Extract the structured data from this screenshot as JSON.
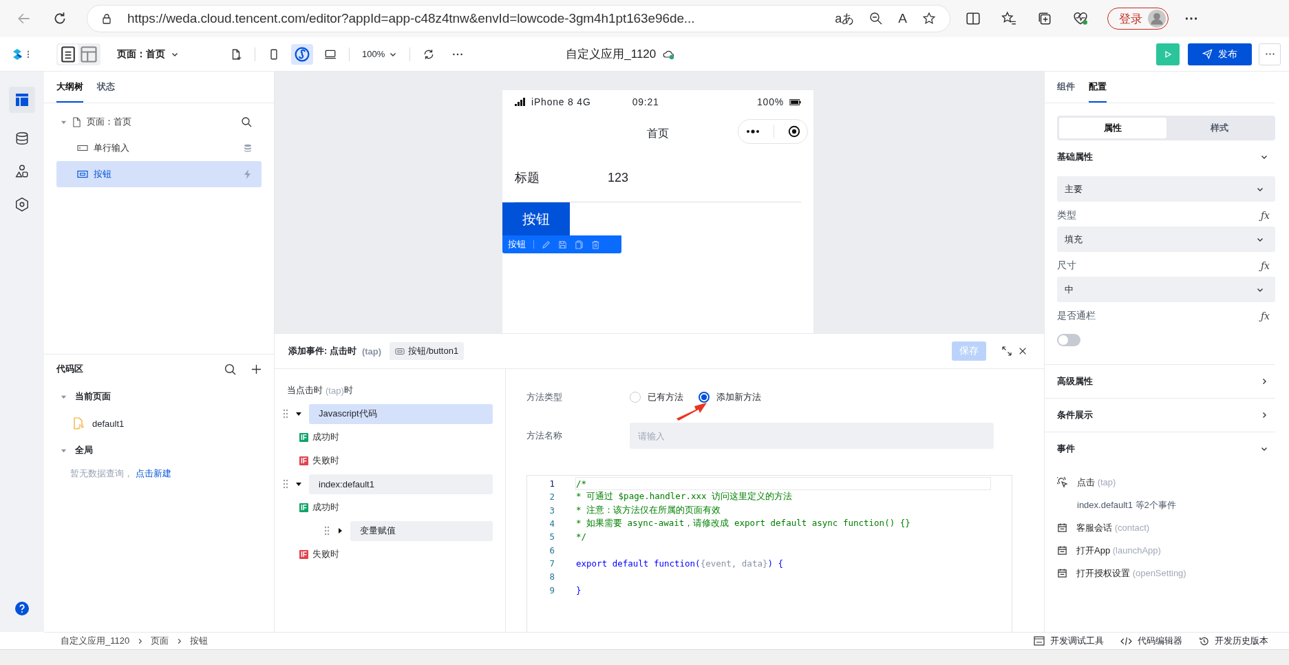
{
  "browser": {
    "url": "https://weda.cloud.tencent.com/editor?appId=app-c48z4tnw&envId=lowcode-3gm4h1pt163e96de...",
    "translate_glyph": "aあ",
    "read_aloud_glyph": "A",
    "login_label": "登录"
  },
  "header": {
    "page_selector": "页面：首页",
    "zoom": "100%",
    "app_title": "自定义应用_1120",
    "publish_label": "发布"
  },
  "left_tabs": [
    {
      "label": "大纲树",
      "selected": true
    },
    {
      "label": "状态",
      "selected": false
    }
  ],
  "outline": [
    {
      "kind": "page",
      "label": "页面：首页",
      "expanded": true,
      "selected": false,
      "children": [
        {
          "kind": "input",
          "label": "单行输入",
          "selected": false
        },
        {
          "kind": "button",
          "label": "按钮",
          "selected": true
        }
      ]
    }
  ],
  "code_area": {
    "title": "代码区",
    "groups": [
      {
        "label": "当前页面",
        "expanded": true,
        "files": [
          "default1"
        ]
      },
      {
        "label": "全局",
        "expanded": true,
        "empty_text": "暂无数据查询，",
        "empty_link": "点击新建"
      }
    ]
  },
  "phone": {
    "carrier": "iPhone 8  4G",
    "time": "09:21",
    "battery": "100%",
    "nav_title": "首页",
    "field_label": "标题",
    "field_value": "123",
    "button_label": "按钮",
    "toolbar_label": "按钮"
  },
  "dialog": {
    "title": "添加事件: 点击时",
    "title_code": "(tap)",
    "component_chip": "按钮/button1",
    "save_label": "保存",
    "save_disabled": true,
    "flow_header": {
      "prefix": "当点击时",
      "code": "(tap)",
      "suffix": "时"
    },
    "flow": [
      {
        "kind": "action",
        "label": "Javascript代码",
        "expanded": true,
        "selected": true,
        "children": [
          {
            "kind": "branch",
            "failure": false,
            "badge": "IF",
            "label": "成功时"
          },
          {
            "kind": "branch",
            "failure": true,
            "badge": "IF",
            "label": "失败时"
          }
        ]
      },
      {
        "kind": "action",
        "label": "index:default1",
        "expanded": true,
        "selected": false,
        "children": [
          {
            "kind": "branch",
            "failure": false,
            "badge": "IF",
            "label": "成功时",
            "children": [
              {
                "kind": "action",
                "label": "变量赋值",
                "expanded": false,
                "selected": false
              }
            ]
          },
          {
            "kind": "branch",
            "failure": true,
            "badge": "IF",
            "label": "失败时"
          }
        ]
      }
    ],
    "method_type_label": "方法类型",
    "method_options": [
      {
        "label": "已有方法",
        "selected": false
      },
      {
        "label": "添加新方法",
        "selected": true
      }
    ],
    "method_name_label": "方法名称",
    "method_name_placeholder": "请输入",
    "code_lines": [
      {
        "number": "1",
        "current": true,
        "tokens": [
          {
            "kind": "comment",
            "text": "/*"
          }
        ]
      },
      {
        "number": "2",
        "current": false,
        "tokens": [
          {
            "kind": "comment",
            "text": "* 可通过 $page.handler.xxx 访问这里定义的方法"
          }
        ]
      },
      {
        "number": "3",
        "current": false,
        "tokens": [
          {
            "kind": "comment",
            "text": "* 注意：该方法仅在所属的页面有效"
          }
        ]
      },
      {
        "number": "4",
        "current": false,
        "tokens": [
          {
            "kind": "comment",
            "text": "* 如果需要 async-await，请修改成 export default async function() {}"
          }
        ]
      },
      {
        "number": "5",
        "current": false,
        "tokens": [
          {
            "kind": "comment",
            "text": "*/"
          }
        ]
      },
      {
        "number": "6",
        "current": false
      },
      {
        "number": "7",
        "current": false,
        "tokens": [
          {
            "kind": "keyword",
            "text": "export default function("
          },
          {
            "kind": "param",
            "text": "{event, data}"
          },
          {
            "kind": "keyword",
            "text": ") {"
          }
        ]
      },
      {
        "number": "8",
        "current": false
      },
      {
        "number": "9",
        "current": false,
        "tokens": [
          {
            "kind": "keyword",
            "text": "}"
          }
        ]
      }
    ]
  },
  "right_tabs": [
    {
      "label": "组件",
      "selected": false
    },
    {
      "label": "配置",
      "selected": true
    }
  ],
  "segments": [
    {
      "label": "属性",
      "selected": true
    },
    {
      "label": "样式",
      "selected": false
    }
  ],
  "basic_section": {
    "title": "基础属性",
    "expanded": true,
    "fields": [
      {
        "kind": "select",
        "value": "主要"
      },
      {
        "kind": "label",
        "label": "类型",
        "fx": "ƒx"
      },
      {
        "kind": "select",
        "value": "填充"
      },
      {
        "kind": "label",
        "label": "尺寸",
        "fx": "ƒx"
      },
      {
        "kind": "select",
        "value": "中"
      },
      {
        "kind": "label",
        "label": "是否通栏",
        "fx": "ƒx"
      },
      {
        "kind": "toggle",
        "on": false
      }
    ]
  },
  "collapsed_sections": [
    {
      "title": "高级属性",
      "expanded": false
    },
    {
      "title": "条件展示",
      "expanded": false
    }
  ],
  "events_section": {
    "title": "事件",
    "expanded": true,
    "events": [
      {
        "kind": "tap",
        "label": "点击",
        "code": "(tap)",
        "detail": "index.default1 等2个事件"
      },
      {
        "kind": "calendar",
        "label": "客服会话",
        "code": "(contact)"
      },
      {
        "kind": "calendar",
        "label": "打开App",
        "code": "(launchApp)"
      },
      {
        "kind": "calendar",
        "label": "打开授权设置",
        "code": "(openSetting)"
      }
    ]
  },
  "breadcrumb": [
    "自定义应用_1120",
    "页面",
    "按钮"
  ],
  "bottom_tools": [
    {
      "kind": "debug",
      "label": "开发调试工具"
    },
    {
      "kind": "code",
      "label": "代码编辑器"
    },
    {
      "kind": "history",
      "label": "开发历史版本"
    }
  ]
}
